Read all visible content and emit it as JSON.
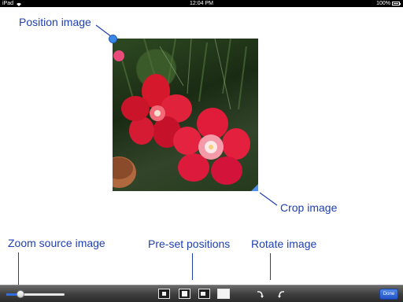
{
  "status_bar": {
    "device": "iPad",
    "time": "12:04 PM",
    "battery": "100%"
  },
  "annotations": {
    "position_image": "Position image",
    "crop_image": "Crop image",
    "zoom_source": "Zoom source image",
    "preset_positions": "Pre-set positions",
    "rotate_image": "Rotate image"
  },
  "toolbar": {
    "zoom_level": 0.2,
    "done_label": "Done"
  },
  "icons": {
    "wifi": "wifi-icon",
    "battery": "battery-icon",
    "rotate_left": "rotate-left-icon",
    "rotate_right": "rotate-right-icon"
  },
  "colors": {
    "annotation": "#1f3fb0",
    "handle": "#3c86e6",
    "done_button": "#2f6de0"
  }
}
